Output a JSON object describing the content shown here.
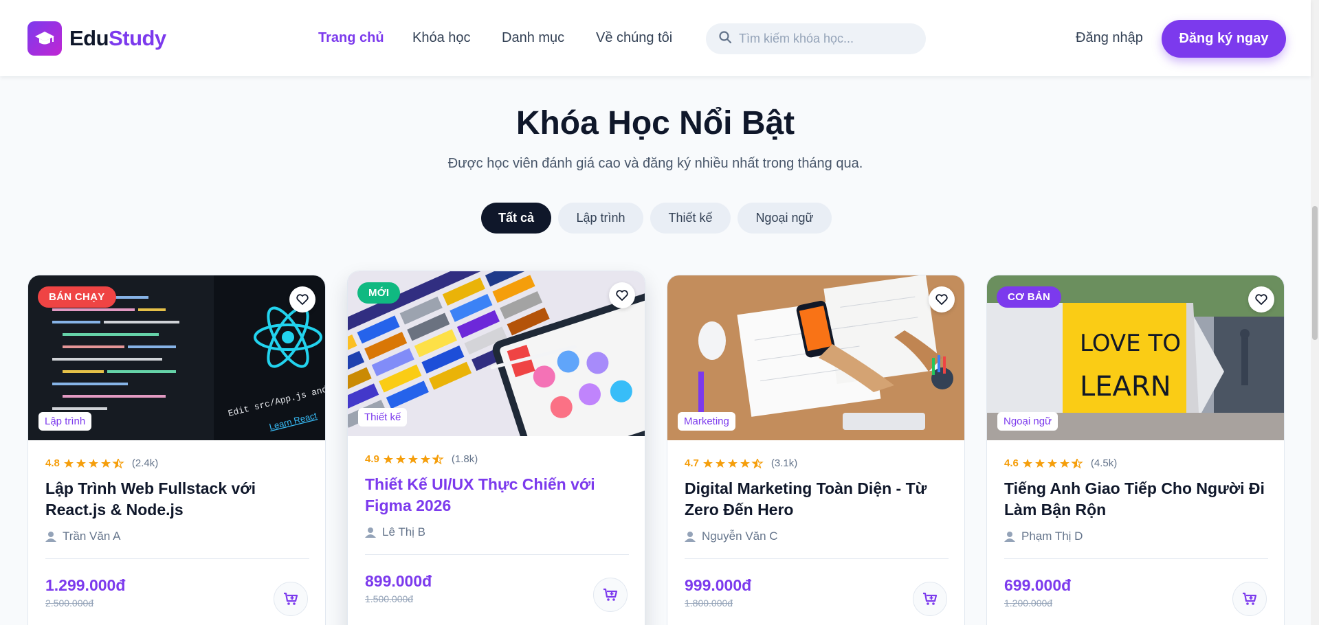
{
  "brand": {
    "part1": "Edu",
    "part2": "Study"
  },
  "nav": {
    "items": [
      "Trang chủ",
      "Khóa học",
      "Danh mục",
      "Về chúng tôi"
    ],
    "active_color": "#7c3aed"
  },
  "search": {
    "placeholder": "Tìm kiếm khóa học..."
  },
  "auth": {
    "login": "Đăng nhập",
    "signup": "Đăng ký ngay"
  },
  "section": {
    "title": "Khóa Học Nổi Bật",
    "subtitle": "Được học viên đánh giá cao và đăng ký nhiều nhất trong tháng qua."
  },
  "filters": [
    "Tất cả",
    "Lập trình",
    "Thiết kế",
    "Ngoại ngữ"
  ],
  "colors": {
    "accent": "#7c3aed",
    "star": "#f59e0b",
    "bestseller": "#ef4444",
    "new": "#10b981",
    "basic": "#7c3aed"
  },
  "courses": [
    {
      "badge": "BÁN CHẠY",
      "category": "Lập trình",
      "rating": "4.8",
      "reviews": "(2.4k)",
      "stars": 4.5,
      "title": "Lập Trình Web Fullstack với React.js & Node.js",
      "author": "Trần Văn A",
      "price": "1.299.000đ",
      "old_price": "2.500.000đ",
      "image": "code-editor-react"
    },
    {
      "badge": "MỚI",
      "category": "Thiết kế",
      "rating": "4.9",
      "reviews": "(1.8k)",
      "stars": 4.5,
      "title": "Thiết Kế UI/UX Thực Chiến với Figma 2026",
      "author": "Lê Thị B",
      "price": "899.000đ",
      "old_price": "1.500.000đ",
      "image": "color-swatches-tablet"
    },
    {
      "badge": "",
      "category": "Marketing",
      "rating": "4.7",
      "reviews": "(3.1k)",
      "stars": 4.5,
      "title": "Digital Marketing Toàn Diện - Từ Zero Đến Hero",
      "author": "Nguyễn Văn C",
      "price": "999.000đ",
      "old_price": "1.800.000đ",
      "image": "desk-planning"
    },
    {
      "badge": "CƠ BẢN",
      "category": "Ngoại ngữ",
      "rating": "4.6",
      "reviews": "(4.5k)",
      "stars": 4.5,
      "title": "Tiếng Anh Giao Tiếp Cho Người Đi Làm Bận Rộn",
      "author": "Phạm Thị D",
      "price": "699.000đ",
      "old_price": "1.200.000đ",
      "image": "love-to-learn-pencil",
      "image_text": [
        "LOVE TO",
        "LEARN"
      ]
    }
  ]
}
